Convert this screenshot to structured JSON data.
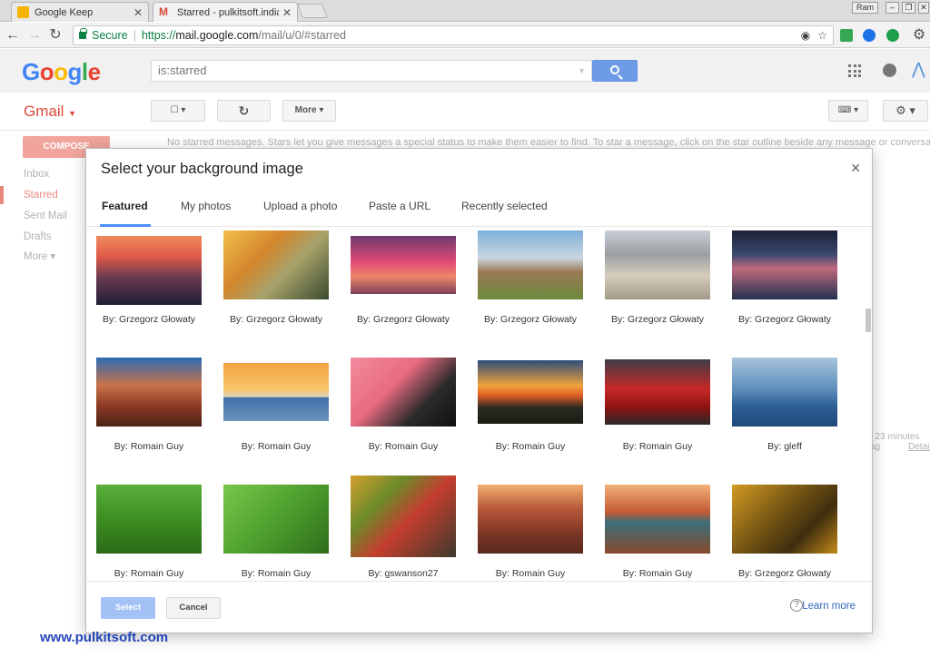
{
  "browser": {
    "tabs": [
      {
        "label": "Google Keep",
        "icon": "keep-icon"
      },
      {
        "label": "Starred - pulkitsoft.india@g",
        "icon": "gmail-icon"
      }
    ],
    "user_badge": "Ram",
    "secure_label": "Secure",
    "url_scheme": "https://",
    "url_host": "mail.google.com",
    "url_path": "/mail/u/0/#starred"
  },
  "gmail": {
    "logo": "Google",
    "search_value": "is:starred",
    "app_label": "Gmail",
    "more_label": "More",
    "compose_label": "COMPOSE",
    "nav": [
      "Inbox",
      "Starred",
      "Sent Mail",
      "Drafts",
      "More"
    ],
    "notice": "No starred messages. Stars let you give messages a special status to make them easier to find. To star a message, click on the star outline beside any message or conversation.",
    "right_fragment_1": ": 23 minutes ag",
    "right_fragment_2": "Detail"
  },
  "dialog": {
    "title": "Select your background image",
    "tabs": [
      "Featured",
      "My photos",
      "Upload a photo",
      "Paste a URL",
      "Recently selected"
    ],
    "active_tab": "Featured",
    "images": [
      {
        "credit": "By: Grzegorz Głowaty",
        "subject": "city-sunset"
      },
      {
        "credit": "By: Grzegorz Głowaty",
        "subject": "autumn-park"
      },
      {
        "credit": "By: Grzegorz Głowaty",
        "subject": "pink-sky-skyline"
      },
      {
        "credit": "By: Grzegorz Głowaty",
        "subject": "shipwreck"
      },
      {
        "credit": "By: Grzegorz Głowaty",
        "subject": "beach"
      },
      {
        "credit": "By: Grzegorz Głowaty",
        "subject": "storm-clouds"
      },
      {
        "credit": "By: Romain Guy",
        "subject": "canyon-rocks"
      },
      {
        "credit": "By: Romain Guy",
        "subject": "calm-sea-sunset"
      },
      {
        "credit": "By: Romain Guy",
        "subject": "flamingo"
      },
      {
        "credit": "By: Romain Guy",
        "subject": "mountain-sunset"
      },
      {
        "credit": "By: Romain Guy",
        "subject": "red-car"
      },
      {
        "credit": "By: gleff",
        "subject": "whale"
      },
      {
        "credit": "By: Romain Guy",
        "subject": "grass"
      },
      {
        "credit": "By: Romain Guy",
        "subject": "grass-closeup"
      },
      {
        "credit": "By: gswanson27",
        "subject": "market-boat"
      },
      {
        "credit": "By: Romain Guy",
        "subject": "red-canyon"
      },
      {
        "credit": "By: Romain Guy",
        "subject": "horseshoe-bend"
      },
      {
        "credit": "By: Grzegorz Głowaty",
        "subject": "autumn-leaves"
      }
    ],
    "select_label": "Select",
    "cancel_label": "Cancel",
    "learn_more_label": "Learn more"
  },
  "watermark": "www.pulkitsoft.com",
  "colors": {
    "gmail_red": "#dd4b39",
    "accent_blue": "#4d90fe",
    "secure_green": "#0b8043"
  }
}
